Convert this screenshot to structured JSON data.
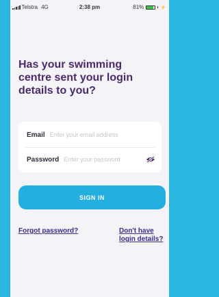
{
  "status_bar": {
    "carrier": "Telstra",
    "network": "4G",
    "time": "2:38 pm",
    "battery": "81%",
    "battery_level": 0.81
  },
  "login": {
    "headline": "Has your swimming centre sent your login details to you?",
    "email_label": "Email",
    "email_placeholder": "Enter your email address",
    "password_label": "Password",
    "password_placeholder": "Enter your password",
    "sign_in_label": "SIGN IN",
    "forgot_password_link": "Forgot password?",
    "no_login_details_link": "Don't have login details?"
  },
  "icons": {
    "password_toggle": "eye-hidden-icon",
    "charging": "bolt-icon"
  },
  "colors": {
    "background": "#29b6e0",
    "screen": "#f4f3f8",
    "headline": "#4a2a6a",
    "button": "#25aee0",
    "link": "#3b2b8c",
    "eye_icon": "#4a2a6a",
    "battery_fill": "#3fc44a"
  }
}
